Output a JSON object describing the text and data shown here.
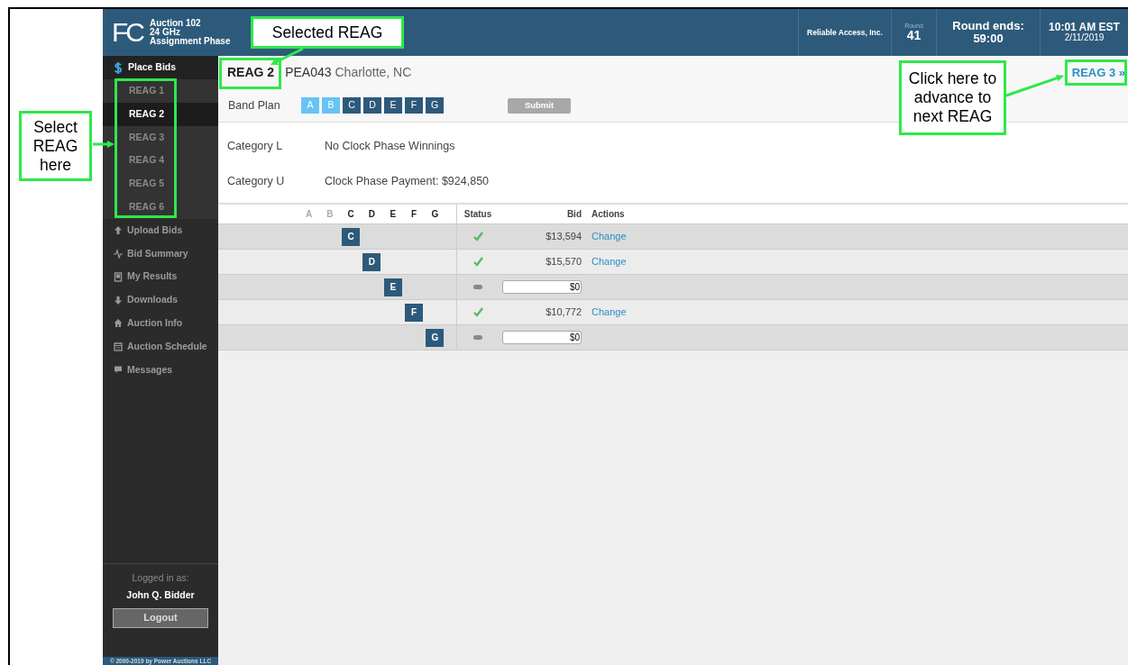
{
  "header": {
    "logo": "FC",
    "title_lines": [
      "Auction 102",
      "24 GHz",
      "Assignment Phase"
    ],
    "company": "Reliable Access, Inc.",
    "round_label": "Round",
    "round": "41",
    "round_ends_label": "Round ends:",
    "round_ends": "59:00",
    "time": "10:01 AM EST",
    "date": "2/11/2019"
  },
  "sidebar": {
    "place_bids": "Place Bids",
    "reags": [
      {
        "label": "REAG 1",
        "selected": false
      },
      {
        "label": "REAG 2",
        "selected": true
      },
      {
        "label": "REAG 3",
        "selected": false
      },
      {
        "label": "REAG 4",
        "selected": false
      },
      {
        "label": "REAG 5",
        "selected": false
      },
      {
        "label": "REAG 6",
        "selected": false
      }
    ],
    "items": [
      {
        "label": "Upload Bids",
        "kind": "upload"
      },
      {
        "label": "Bid Summary",
        "kind": "pulse"
      },
      {
        "label": "My Results",
        "kind": "book"
      },
      {
        "label": "Downloads",
        "kind": "download"
      },
      {
        "label": "Auction Info",
        "kind": "home"
      },
      {
        "label": "Auction Schedule",
        "kind": "calendar"
      },
      {
        "label": "Messages",
        "kind": "chat"
      }
    ],
    "logged_in_label": "Logged in as:",
    "user": "John Q. Bidder",
    "logout": "Logout",
    "copyright": "© 2000-2019 by Power Auctions LLC"
  },
  "main": {
    "reag": "REAG 2",
    "pea_code": "PEA043",
    "pea_name": "Charlotte, NC",
    "next_link": "REAG 3 »",
    "band_plan_label": "Band Plan",
    "bands": [
      {
        "label": "A",
        "available": false
      },
      {
        "label": "B",
        "available": false
      },
      {
        "label": "C",
        "available": true
      },
      {
        "label": "D",
        "available": true
      },
      {
        "label": "E",
        "available": true
      },
      {
        "label": "F",
        "available": true
      },
      {
        "label": "G",
        "available": true
      }
    ],
    "submit": "Submit",
    "categories": [
      {
        "label": "Category L",
        "value": "No Clock Phase Winnings"
      },
      {
        "label": "Category U",
        "value": "Clock Phase Payment: $924,850"
      }
    ],
    "table": {
      "band_columns": [
        {
          "label": "A",
          "available": false
        },
        {
          "label": "B",
          "available": false
        },
        {
          "label": "C",
          "available": true
        },
        {
          "label": "D",
          "available": true
        },
        {
          "label": "E",
          "available": true
        },
        {
          "label": "F",
          "available": true
        },
        {
          "label": "G",
          "available": true
        }
      ],
      "status": "Status",
      "bid": "Bid",
      "actions": "Actions",
      "rows": [
        {
          "band": "C",
          "filled": [
            false,
            false,
            true,
            false,
            false,
            false,
            false
          ],
          "status_ok": true,
          "editable": false,
          "bid": "$13,594",
          "action": "Change"
        },
        {
          "band": "D",
          "filled": [
            false,
            false,
            false,
            true,
            false,
            false,
            false
          ],
          "status_ok": true,
          "editable": false,
          "bid": "$15,570",
          "action": "Change"
        },
        {
          "band": "E",
          "filled": [
            false,
            false,
            false,
            false,
            true,
            false,
            false
          ],
          "status_ok": false,
          "editable": true,
          "bid": "$0"
        },
        {
          "band": "F",
          "filled": [
            false,
            false,
            false,
            false,
            false,
            true,
            false
          ],
          "status_ok": true,
          "editable": false,
          "bid": "$10,772",
          "action": "Change"
        },
        {
          "band": "G",
          "filled": [
            false,
            false,
            false,
            false,
            false,
            false,
            true
          ],
          "status_ok": false,
          "editable": true,
          "bid": "$0"
        }
      ]
    }
  },
  "annotations": [
    {
      "kind": "selected-reag",
      "text": "Selected REAG"
    },
    {
      "kind": "select-reag",
      "text": "Select REAG here"
    },
    {
      "kind": "next-reag",
      "text": "Click here to advance to next REAG"
    }
  ]
}
